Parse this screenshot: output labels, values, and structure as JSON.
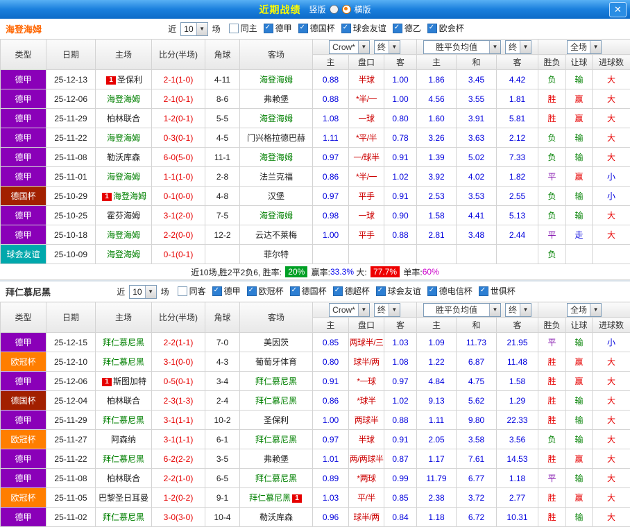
{
  "titlebar": {
    "title": "近期战绩",
    "options": [
      {
        "label": "竖版",
        "selected": false
      },
      {
        "label": "横版",
        "selected": true
      }
    ],
    "close_label": "✕"
  },
  "type_colors": {
    "德甲": "#8a00b8",
    "德国杯": "#a22000",
    "球会友谊": "#00a8ac",
    "欧冠杯": "#ff7e00"
  },
  "sections": [
    {
      "team": "海登海姆",
      "team_color": "#ff6600",
      "filters": {
        "near_label": "近",
        "rounds": "10",
        "games_label": "场",
        "items": [
          {
            "label": "同主",
            "checked": false
          },
          {
            "label": "德甲",
            "checked": true
          },
          {
            "label": "德国杯",
            "checked": true
          },
          {
            "label": "球会友谊",
            "checked": true
          },
          {
            "label": "德乙",
            "checked": true
          },
          {
            "label": "欧会杯",
            "checked": true
          }
        ]
      },
      "table": {
        "header": {
          "type": "类型",
          "date": "日期",
          "home": "主场",
          "score": "比分(半场)",
          "corner": "角球",
          "away": "客场",
          "odds_company": "Crow*",
          "odds_final": "终",
          "avg_label": "胜平负均值",
          "avg_final": "终",
          "scope": "全场",
          "sub": [
            "主",
            "盘口",
            "客",
            "主",
            "和",
            "客",
            "胜负",
            "让球",
            "进球数"
          ]
        },
        "rows": [
          {
            "type": "德甲",
            "date": "25-12-13",
            "home": {
              "name": "圣保利",
              "focus": false,
              "badge": "1"
            },
            "score": "2-1(1-0)",
            "corner": "4-11",
            "away": {
              "name": "海登海姆",
              "focus": true
            },
            "odds": [
              "0.88",
              "半球",
              "1.00"
            ],
            "avg": [
              "1.86",
              "3.45",
              "4.42"
            ],
            "result": {
              "t": "负",
              "c": "green"
            },
            "handicap": {
              "t": "输",
              "c": "green"
            },
            "goal": {
              "t": "大",
              "c": "red"
            }
          },
          {
            "type": "德甲",
            "date": "25-12-06",
            "home": {
              "name": "海登海姆",
              "focus": true
            },
            "score": "2-1(0-1)",
            "corner": "8-6",
            "away": {
              "name": "弗赖堡",
              "focus": false
            },
            "odds": [
              "0.88",
              "*半/一",
              "1.00"
            ],
            "avg": [
              "4.56",
              "3.55",
              "1.81"
            ],
            "result": {
              "t": "胜",
              "c": "red"
            },
            "handicap": {
              "t": "赢",
              "c": "red"
            },
            "goal": {
              "t": "大",
              "c": "red"
            }
          },
          {
            "type": "德甲",
            "date": "25-11-29",
            "home": {
              "name": "柏林联合",
              "focus": false
            },
            "score": "1-2(0-1)",
            "corner": "5-5",
            "away": {
              "name": "海登海姆",
              "focus": true
            },
            "odds": [
              "1.08",
              "一球",
              "0.80"
            ],
            "avg": [
              "1.60",
              "3.91",
              "5.81"
            ],
            "result": {
              "t": "胜",
              "c": "red"
            },
            "handicap": {
              "t": "赢",
              "c": "red"
            },
            "goal": {
              "t": "大",
              "c": "red"
            }
          },
          {
            "type": "德甲",
            "date": "25-11-22",
            "home": {
              "name": "海登海姆",
              "focus": true
            },
            "score": "0-3(0-1)",
            "corner": "4-5",
            "away": {
              "name": "门兴格拉德巴赫",
              "focus": false
            },
            "odds": [
              "1.11",
              "*平/半",
              "0.78"
            ],
            "avg": [
              "3.26",
              "3.63",
              "2.12"
            ],
            "result": {
              "t": "负",
              "c": "green"
            },
            "handicap": {
              "t": "输",
              "c": "green"
            },
            "goal": {
              "t": "大",
              "c": "red"
            }
          },
          {
            "type": "德甲",
            "date": "25-11-08",
            "home": {
              "name": "勒沃库森",
              "focus": false
            },
            "score": "6-0(5-0)",
            "corner": "11-1",
            "away": {
              "name": "海登海姆",
              "focus": true
            },
            "odds": [
              "0.97",
              "一/球半",
              "0.91"
            ],
            "avg": [
              "1.39",
              "5.02",
              "7.33"
            ],
            "result": {
              "t": "负",
              "c": "green"
            },
            "handicap": {
              "t": "输",
              "c": "green"
            },
            "goal": {
              "t": "大",
              "c": "red"
            }
          },
          {
            "type": "德甲",
            "date": "25-11-01",
            "home": {
              "name": "海登海姆",
              "focus": true
            },
            "score": "1-1(1-0)",
            "corner": "2-8",
            "away": {
              "name": "法兰克福",
              "focus": false
            },
            "odds": [
              "0.86",
              "*半/一",
              "1.02"
            ],
            "avg": [
              "3.92",
              "4.02",
              "1.82"
            ],
            "result": {
              "t": "平",
              "c": "purple"
            },
            "handicap": {
              "t": "赢",
              "c": "red"
            },
            "goal": {
              "t": "小",
              "c": "blue"
            }
          },
          {
            "type": "德国杯",
            "date": "25-10-29",
            "home": {
              "name": "海登海姆",
              "focus": true,
              "badge": "1"
            },
            "score": "0-1(0-0)",
            "corner": "4-8",
            "away": {
              "name": "汉堡",
              "focus": false
            },
            "odds": [
              "0.97",
              "平手",
              "0.91"
            ],
            "avg": [
              "2.53",
              "3.53",
              "2.55"
            ],
            "result": {
              "t": "负",
              "c": "green"
            },
            "handicap": {
              "t": "输",
              "c": "green"
            },
            "goal": {
              "t": "小",
              "c": "blue"
            }
          },
          {
            "type": "德甲",
            "date": "25-10-25",
            "home": {
              "name": "霍芬海姆",
              "focus": false
            },
            "score": "3-1(2-0)",
            "corner": "7-5",
            "away": {
              "name": "海登海姆",
              "focus": true
            },
            "odds": [
              "0.98",
              "一球",
              "0.90"
            ],
            "avg": [
              "1.58",
              "4.41",
              "5.13"
            ],
            "result": {
              "t": "负",
              "c": "green"
            },
            "handicap": {
              "t": "输",
              "c": "green"
            },
            "goal": {
              "t": "大",
              "c": "red"
            }
          },
          {
            "type": "德甲",
            "date": "25-10-18",
            "home": {
              "name": "海登海姆",
              "focus": true
            },
            "score": "2-2(0-0)",
            "corner": "12-2",
            "away": {
              "name": "云达不莱梅",
              "focus": false
            },
            "odds": [
              "1.00",
              "平手",
              "0.88"
            ],
            "avg": [
              "2.81",
              "3.48",
              "2.44"
            ],
            "result": {
              "t": "平",
              "c": "purple"
            },
            "handicap": {
              "t": "走",
              "c": "blue"
            },
            "goal": {
              "t": "大",
              "c": "red"
            }
          },
          {
            "type": "球会友谊",
            "date": "25-10-09",
            "home": {
              "name": "海登海姆",
              "focus": true
            },
            "score": "0-1(0-1)",
            "corner": "",
            "away": {
              "name": "菲尔特",
              "focus": false
            },
            "odds": [
              "",
              "",
              ""
            ],
            "avg": [
              "",
              "",
              ""
            ],
            "result": {
              "t": "负",
              "c": "green"
            },
            "handicap": null,
            "goal": null
          }
        ]
      },
      "summary": {
        "parts": [
          {
            "t": "近10场,胜2平2负6, 胜率: ",
            "style": "plain"
          },
          {
            "t": "20%",
            "style": "badge-green"
          },
          {
            "t": " 赢率:",
            "style": "plain"
          },
          {
            "t": "33.3%",
            "style": "blue"
          },
          {
            "t": " 大: ",
            "style": "plain"
          },
          {
            "t": "77.7%",
            "style": "badge-red"
          },
          {
            "t": " 单率:",
            "style": "plain"
          },
          {
            "t": "60%",
            "style": "purple"
          }
        ]
      }
    },
    {
      "team": "拜仁慕尼黑",
      "team_color": "#333333",
      "filters": {
        "near_label": "近",
        "rounds": "10",
        "games_label": "场",
        "items": [
          {
            "label": "同客",
            "checked": false
          },
          {
            "label": "德甲",
            "checked": true
          },
          {
            "label": "欧冠杯",
            "checked": true
          },
          {
            "label": "德国杯",
            "checked": true
          },
          {
            "label": "德超杯",
            "checked": true
          },
          {
            "label": "球会友谊",
            "checked": true
          },
          {
            "label": "德电信杯",
            "checked": true
          },
          {
            "label": "世俱杯",
            "checked": true
          }
        ]
      },
      "table": {
        "header": {
          "type": "类型",
          "date": "日期",
          "home": "主场",
          "score": "比分(半场)",
          "corner": "角球",
          "away": "客场",
          "odds_company": "Crow*",
          "odds_final": "终",
          "avg_label": "胜平负均值",
          "avg_final": "终",
          "scope": "全场",
          "sub": [
            "主",
            "盘口",
            "客",
            "主",
            "和",
            "客",
            "胜负",
            "让球",
            "进球数"
          ]
        },
        "rows": [
          {
            "type": "德甲",
            "date": "25-12-15",
            "home": {
              "name": "拜仁慕尼黑",
              "focus": true
            },
            "score": "2-2(1-1)",
            "corner": "7-0",
            "away": {
              "name": "美因茨",
              "focus": false
            },
            "odds": [
              "0.85",
              "两球半/三",
              "1.03"
            ],
            "avg": [
              "1.09",
              "11.73",
              "21.95"
            ],
            "result": {
              "t": "平",
              "c": "purple"
            },
            "handicap": {
              "t": "输",
              "c": "green"
            },
            "goal": {
              "t": "小",
              "c": "blue"
            }
          },
          {
            "type": "欧冠杯",
            "date": "25-12-10",
            "home": {
              "name": "拜仁慕尼黑",
              "focus": true
            },
            "score": "3-1(0-0)",
            "corner": "4-3",
            "away": {
              "name": "葡萄牙体育",
              "focus": false
            },
            "odds": [
              "0.80",
              "球半/两",
              "1.08"
            ],
            "avg": [
              "1.22",
              "6.87",
              "11.48"
            ],
            "result": {
              "t": "胜",
              "c": "red"
            },
            "handicap": {
              "t": "赢",
              "c": "red"
            },
            "goal": {
              "t": "大",
              "c": "red"
            }
          },
          {
            "type": "德甲",
            "date": "25-12-06",
            "home": {
              "name": "斯图加特",
              "focus": false,
              "badge": "1"
            },
            "score": "0-5(0-1)",
            "corner": "3-4",
            "away": {
              "name": "拜仁慕尼黑",
              "focus": true
            },
            "odds": [
              "0.91",
              "*一球",
              "0.97"
            ],
            "avg": [
              "4.84",
              "4.75",
              "1.58"
            ],
            "result": {
              "t": "胜",
              "c": "red"
            },
            "handicap": {
              "t": "赢",
              "c": "red"
            },
            "goal": {
              "t": "大",
              "c": "red"
            }
          },
          {
            "type": "德国杯",
            "date": "25-12-04",
            "home": {
              "name": "柏林联合",
              "focus": false
            },
            "score": "2-3(1-3)",
            "corner": "2-4",
            "away": {
              "name": "拜仁慕尼黑",
              "focus": true
            },
            "odds": [
              "0.86",
              "*球半",
              "1.02"
            ],
            "avg": [
              "9.13",
              "5.62",
              "1.29"
            ],
            "result": {
              "t": "胜",
              "c": "red"
            },
            "handicap": {
              "t": "输",
              "c": "green"
            },
            "goal": {
              "t": "大",
              "c": "red"
            }
          },
          {
            "type": "德甲",
            "date": "25-11-29",
            "home": {
              "name": "拜仁慕尼黑",
              "focus": true
            },
            "score": "3-1(1-1)",
            "corner": "10-2",
            "away": {
              "name": "圣保利",
              "focus": false
            },
            "odds": [
              "1.00",
              "两球半",
              "0.88"
            ],
            "avg": [
              "1.11",
              "9.80",
              "22.33"
            ],
            "result": {
              "t": "胜",
              "c": "red"
            },
            "handicap": {
              "t": "输",
              "c": "green"
            },
            "goal": {
              "t": "大",
              "c": "red"
            }
          },
          {
            "type": "欧冠杯",
            "date": "25-11-27",
            "home": {
              "name": "阿森纳",
              "focus": false
            },
            "score": "3-1(1-1)",
            "corner": "6-1",
            "away": {
              "name": "拜仁慕尼黑",
              "focus": true
            },
            "odds": [
              "0.97",
              "半球",
              "0.91"
            ],
            "avg": [
              "2.05",
              "3.58",
              "3.56"
            ],
            "result": {
              "t": "负",
              "c": "green"
            },
            "handicap": {
              "t": "输",
              "c": "green"
            },
            "goal": {
              "t": "大",
              "c": "red"
            }
          },
          {
            "type": "德甲",
            "date": "25-11-22",
            "home": {
              "name": "拜仁慕尼黑",
              "focus": true
            },
            "score": "6-2(2-2)",
            "corner": "3-5",
            "away": {
              "name": "弗赖堡",
              "focus": false
            },
            "odds": [
              "1.01",
              "两/两球半",
              "0.87"
            ],
            "avg": [
              "1.17",
              "7.61",
              "14.53"
            ],
            "result": {
              "t": "胜",
              "c": "red"
            },
            "handicap": {
              "t": "赢",
              "c": "red"
            },
            "goal": {
              "t": "大",
              "c": "red"
            }
          },
          {
            "type": "德甲",
            "date": "25-11-08",
            "home": {
              "name": "柏林联合",
              "focus": false
            },
            "score": "2-2(1-0)",
            "corner": "6-5",
            "away": {
              "name": "拜仁慕尼黑",
              "focus": true
            },
            "odds": [
              "0.89",
              "*两球",
              "0.99"
            ],
            "avg": [
              "11.79",
              "6.77",
              "1.18"
            ],
            "result": {
              "t": "平",
              "c": "purple"
            },
            "handicap": {
              "t": "输",
              "c": "green"
            },
            "goal": {
              "t": "大",
              "c": "red"
            }
          },
          {
            "type": "欧冠杯",
            "date": "25-11-05",
            "home": {
              "name": "巴黎圣日耳曼",
              "focus": false
            },
            "score": "1-2(0-2)",
            "corner": "9-1",
            "away": {
              "name": "拜仁慕尼黑",
              "focus": true,
              "badge": "1",
              "badge_after": true
            },
            "odds": [
              "1.03",
              "平/半",
              "0.85"
            ],
            "avg": [
              "2.38",
              "3.72",
              "2.77"
            ],
            "result": {
              "t": "胜",
              "c": "red"
            },
            "handicap": {
              "t": "赢",
              "c": "red"
            },
            "goal": {
              "t": "大",
              "c": "red"
            }
          },
          {
            "type": "德甲",
            "date": "25-11-02",
            "home": {
              "name": "拜仁慕尼黑",
              "focus": true
            },
            "score": "3-0(3-0)",
            "corner": "10-4",
            "away": {
              "name": "勒沃库森",
              "focus": false
            },
            "odds": [
              "0.96",
              "球半/两",
              "0.84"
            ],
            "avg": [
              "1.18",
              "6.72",
              "10.31"
            ],
            "result": {
              "t": "胜",
              "c": "red"
            },
            "handicap": {
              "t": "输",
              "c": "green"
            },
            "goal": {
              "t": "大",
              "c": "red"
            }
          }
        ]
      },
      "summary": null
    }
  ]
}
